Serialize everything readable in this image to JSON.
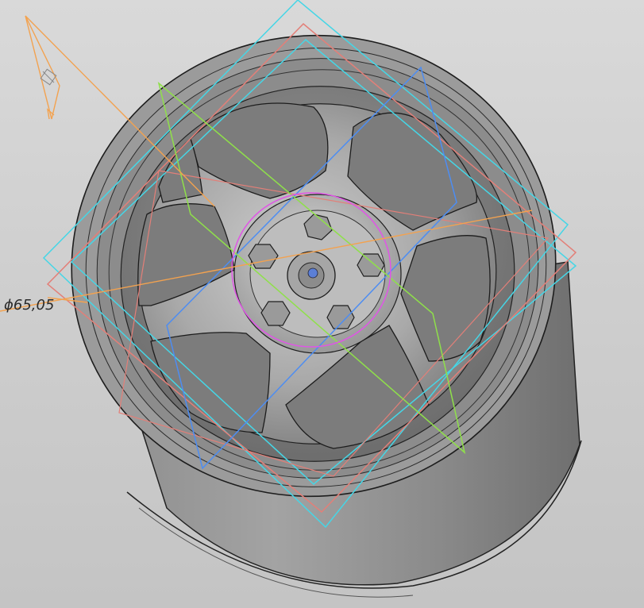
{
  "viewport": {
    "background": "#cfcfcf",
    "model": "wheel-rim",
    "spoke_count": 7,
    "lug_count": 5
  },
  "dimension": {
    "label": "ϕ65,05",
    "color": "#f3a24f"
  },
  "construction_colors": {
    "plane_cyan": "#45d6e6",
    "plane_red": "#e37f78",
    "plane_blue": "#4d8df2",
    "plane_green": "#8fe04a",
    "sketch_orange": "#f3a24f",
    "circle_magenta": "#e055e6"
  }
}
